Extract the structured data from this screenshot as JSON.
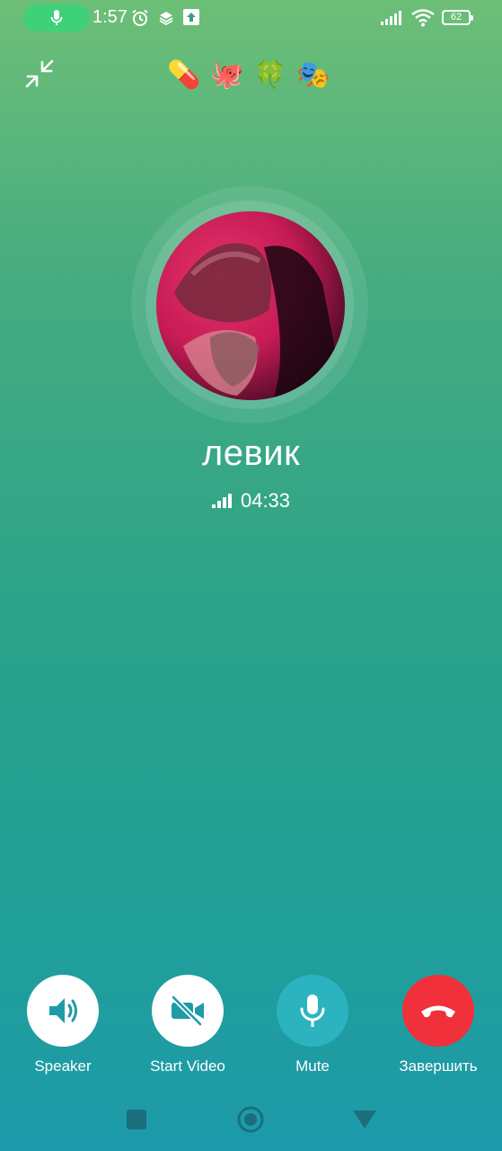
{
  "status_bar": {
    "time": "1:57",
    "battery": "62",
    "icons": [
      "mic-icon",
      "alarm-icon",
      "layers-icon",
      "upload-icon",
      "signal-icon",
      "wifi-icon",
      "battery-icon"
    ]
  },
  "top_bar": {
    "minimize_icon": "collapse-icon",
    "emojis": [
      "💊",
      "🐙",
      "🍀",
      "🎭"
    ]
  },
  "caller": {
    "name": "левик",
    "duration": "04:33",
    "signal_icon": "signal-bars-icon"
  },
  "controls": {
    "speaker_label": "Speaker",
    "video_label": "Start Video",
    "mute_label": "Mute",
    "end_label": "Завершить"
  },
  "colors": {
    "end_call": "#f0303b",
    "mute_bg": "#2bb3c0",
    "mic_pill": "#3fd17a",
    "icon_dark": "#1f9ba8"
  },
  "nav_bar": {
    "icons": [
      "recents-icon",
      "home-icon",
      "back-icon"
    ]
  }
}
